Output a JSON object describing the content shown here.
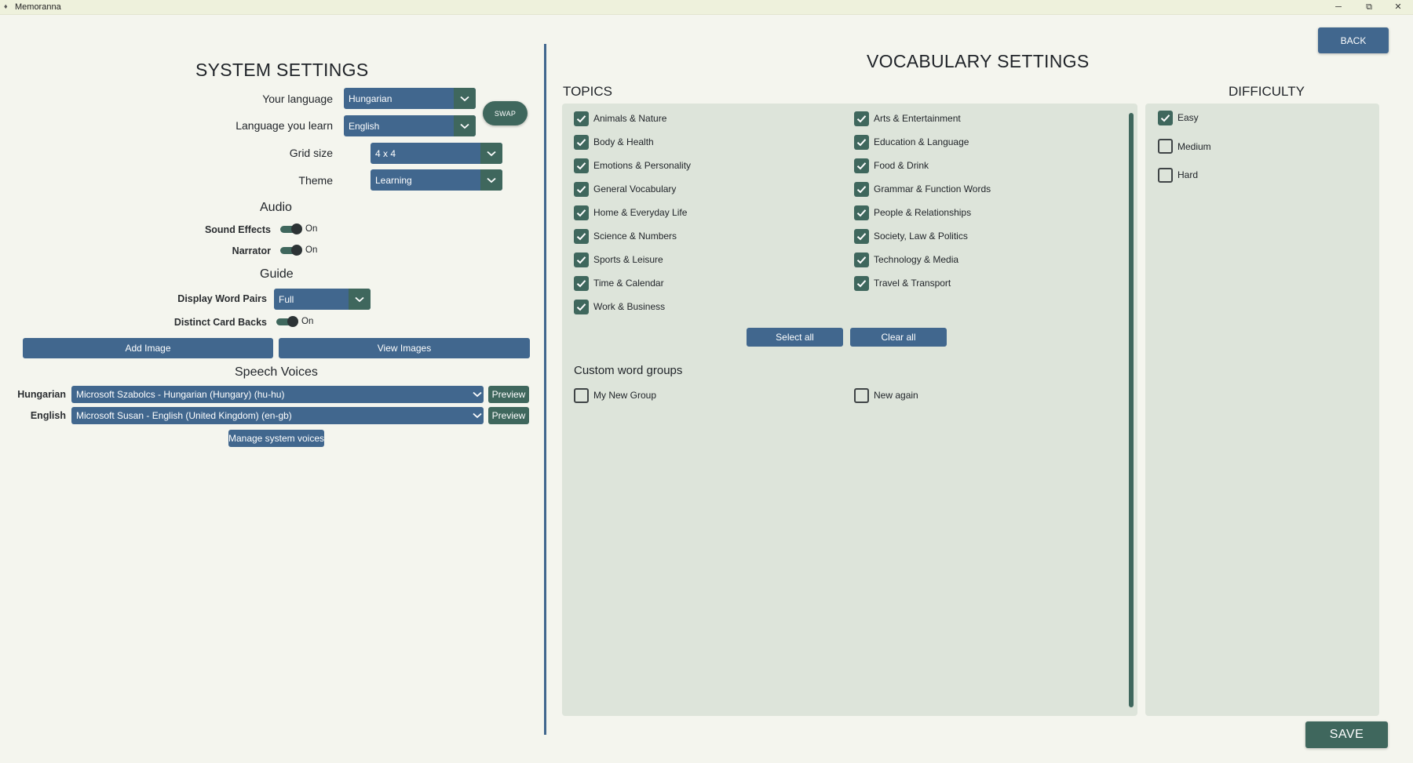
{
  "window": {
    "title": "Memoranna",
    "controls": {
      "minimize": "─",
      "maximize": "⧉",
      "close": "✕"
    }
  },
  "system": {
    "title": "SYSTEM SETTINGS",
    "your_language": {
      "label": "Your language",
      "value": "Hungarian"
    },
    "learn_language": {
      "label": "Language you learn",
      "value": "English"
    },
    "swap_label": "SWAP",
    "grid_size": {
      "label": "Grid size",
      "value": "4 x 4"
    },
    "theme": {
      "label": "Theme",
      "value": "Learning"
    },
    "audio": {
      "title": "Audio",
      "sound_effects": {
        "label": "Sound Effects",
        "state": "On"
      },
      "narrator": {
        "label": "Narrator",
        "state": "On"
      }
    },
    "guide": {
      "title": "Guide",
      "display_word_pairs": {
        "label": "Display Word Pairs",
        "value": "Full"
      },
      "distinct_card_backs": {
        "label": "Distinct Card Backs",
        "state": "On"
      }
    },
    "add_image": "Add Image",
    "view_images": "View Images",
    "speech": {
      "title": "Speech Voices",
      "hungarian": {
        "label": "Hungarian",
        "value": "Microsoft Szabolcs - Hungarian (Hungary) (hu-hu)",
        "preview": "Preview"
      },
      "english": {
        "label": "English",
        "value": "Microsoft Susan - English (United Kingdom) (en-gb)",
        "preview": "Preview"
      },
      "manage": "Manage system voices"
    }
  },
  "vocab": {
    "title": "VOCABULARY SETTINGS",
    "back": "BACK",
    "topics_title": "TOPICS",
    "topics_left": [
      {
        "label": "Animals & Nature",
        "checked": true
      },
      {
        "label": "Body & Health",
        "checked": true
      },
      {
        "label": "Emotions & Personality",
        "checked": true
      },
      {
        "label": "General Vocabulary",
        "checked": true
      },
      {
        "label": "Home & Everyday Life",
        "checked": true
      },
      {
        "label": "Science & Numbers",
        "checked": true
      },
      {
        "label": "Sports & Leisure",
        "checked": true
      },
      {
        "label": "Time & Calendar",
        "checked": true
      },
      {
        "label": "Work & Business",
        "checked": true
      }
    ],
    "topics_right": [
      {
        "label": "Arts & Entertainment",
        "checked": true
      },
      {
        "label": "Education & Language",
        "checked": true
      },
      {
        "label": "Food & Drink",
        "checked": true
      },
      {
        "label": "Grammar & Function Words",
        "checked": true
      },
      {
        "label": "People & Relationships",
        "checked": true
      },
      {
        "label": "Society, Law & Politics",
        "checked": true
      },
      {
        "label": "Technology & Media",
        "checked": true
      },
      {
        "label": "Travel & Transport",
        "checked": true
      }
    ],
    "select_all": "Select all",
    "clear_all": "Clear all",
    "custom_title": "Custom word groups",
    "custom_groups": [
      {
        "label": "My New Group",
        "checked": false
      },
      {
        "label": "New again",
        "checked": false
      }
    ],
    "difficulty_title": "DIFFICULTY",
    "difficulty": [
      {
        "label": "Easy",
        "checked": true
      },
      {
        "label": "Medium",
        "checked": false
      },
      {
        "label": "Hard",
        "checked": false
      }
    ],
    "save": "SAVE"
  },
  "colors": {
    "primary_blue": "#41678e",
    "primary_green": "#3f675d",
    "panel_bg": "#dde4da",
    "page_bg": "#f4f5ee"
  }
}
